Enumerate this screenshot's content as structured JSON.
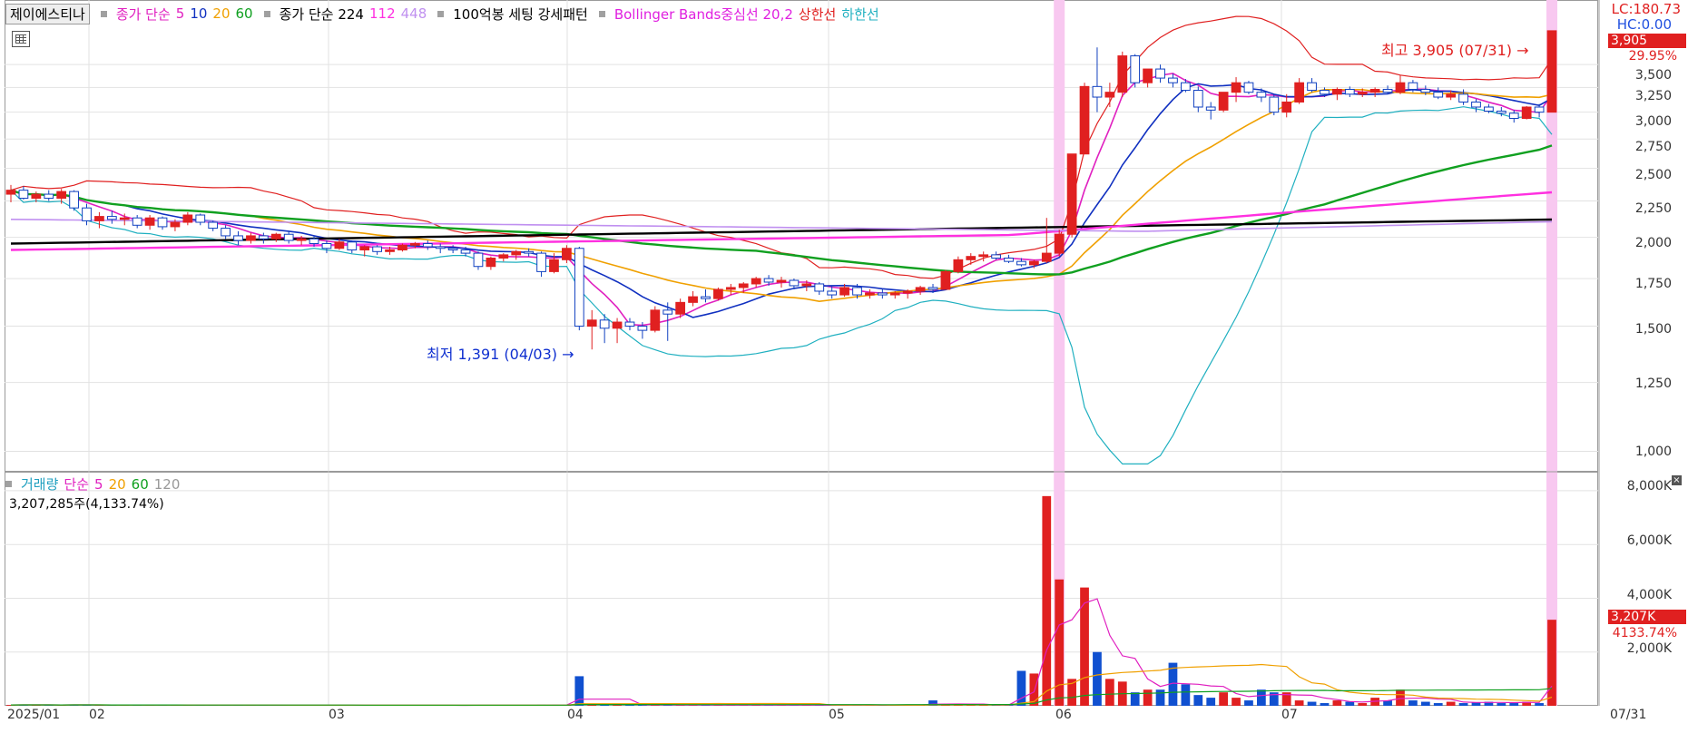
{
  "legend": {
    "name": "제이에스티나",
    "ma_label": "종가 단순",
    "ma_values": [
      "5",
      "10",
      "20",
      "60"
    ],
    "ma_colors": [
      "#e020c0",
      "#1030c0",
      "#f0a000",
      "#10a020"
    ],
    "long_label": "종가 단순 224",
    "long_values": [
      "112",
      "448"
    ],
    "pattern": "100억봉 세팅 강세패턴",
    "bb_label": "Bollinger Bands중심선 20,2",
    "bb_upper": "상한선",
    "bb_lower": "하한선"
  },
  "top_right": {
    "lc": "LC:180.73",
    "hc": "HC:0.00"
  },
  "price_axis": [
    "3,500",
    "3,250",
    "3,000",
    "2,750",
    "2,500",
    "2,250",
    "2,000",
    "1,750",
    "1,500",
    "1,250",
    "1,000"
  ],
  "price_tag": {
    "value": "3,905",
    "pct": "29.95%"
  },
  "high_note": "최고 3,905 (07/31)",
  "low_note": "최저 1,391 (04/03)",
  "volume": {
    "legend_label": "거래량",
    "ma_label": "단순",
    "ma_values": [
      "5",
      "20",
      "60",
      "120"
    ],
    "total": "3,207,285주(4,133.74%)",
    "axis": [
      "8,000K",
      "6,000K",
      "4,000K",
      "2,000K"
    ],
    "tag_value": "3,207K",
    "tag_pct": "4133.74%"
  },
  "months": [
    "2025/01",
    "02",
    "03",
    "04",
    "05",
    "06",
    "07",
    "07/31"
  ],
  "chart_data": {
    "type": "candlestick",
    "title": "제이에스티나",
    "y_scale": "log",
    "ylim": [
      950,
      3950
    ],
    "volume_ylim": [
      0,
      8200
    ],
    "volume_unit": "K",
    "high": 3905,
    "low": 1391,
    "candles": [
      {
        "o": 2300,
        "h": 2370,
        "l": 2240,
        "c": 2330
      },
      {
        "o": 2330,
        "h": 2360,
        "l": 2260,
        "c": 2270
      },
      {
        "o": 2270,
        "h": 2320,
        "l": 2240,
        "c": 2300
      },
      {
        "o": 2300,
        "h": 2330,
        "l": 2250,
        "c": 2270
      },
      {
        "o": 2270,
        "h": 2340,
        "l": 2230,
        "c": 2320
      },
      {
        "o": 2320,
        "h": 2330,
        "l": 2180,
        "c": 2200
      },
      {
        "o": 2200,
        "h": 2230,
        "l": 2080,
        "c": 2110
      },
      {
        "o": 2110,
        "h": 2170,
        "l": 2060,
        "c": 2140
      },
      {
        "o": 2140,
        "h": 2180,
        "l": 2090,
        "c": 2120
      },
      {
        "o": 2120,
        "h": 2160,
        "l": 2080,
        "c": 2130
      },
      {
        "o": 2130,
        "h": 2150,
        "l": 2060,
        "c": 2080
      },
      {
        "o": 2080,
        "h": 2150,
        "l": 2050,
        "c": 2130
      },
      {
        "o": 2130,
        "h": 2140,
        "l": 2050,
        "c": 2070
      },
      {
        "o": 2070,
        "h": 2120,
        "l": 2040,
        "c": 2100
      },
      {
        "o": 2100,
        "h": 2170,
        "l": 2080,
        "c": 2150
      },
      {
        "o": 2150,
        "h": 2160,
        "l": 2080,
        "c": 2100
      },
      {
        "o": 2100,
        "h": 2110,
        "l": 2040,
        "c": 2060
      },
      {
        "o": 2060,
        "h": 2080,
        "l": 1990,
        "c": 2010
      },
      {
        "o": 2010,
        "h": 2040,
        "l": 1950,
        "c": 1980
      },
      {
        "o": 1980,
        "h": 2030,
        "l": 1960,
        "c": 2010
      },
      {
        "o": 2010,
        "h": 2030,
        "l": 1960,
        "c": 1990
      },
      {
        "o": 1990,
        "h": 2030,
        "l": 1970,
        "c": 2020
      },
      {
        "o": 2020,
        "h": 2040,
        "l": 1960,
        "c": 1980
      },
      {
        "o": 1980,
        "h": 2010,
        "l": 1950,
        "c": 1990
      },
      {
        "o": 1990,
        "h": 2010,
        "l": 1940,
        "c": 1960
      },
      {
        "o": 1960,
        "h": 1980,
        "l": 1900,
        "c": 1930
      },
      {
        "o": 1930,
        "h": 1990,
        "l": 1920,
        "c": 1970
      },
      {
        "o": 1970,
        "h": 1980,
        "l": 1900,
        "c": 1920
      },
      {
        "o": 1920,
        "h": 1950,
        "l": 1880,
        "c": 1940
      },
      {
        "o": 1940,
        "h": 1950,
        "l": 1890,
        "c": 1910
      },
      {
        "o": 1910,
        "h": 1940,
        "l": 1890,
        "c": 1920
      },
      {
        "o": 1920,
        "h": 1960,
        "l": 1910,
        "c": 1950
      },
      {
        "o": 1950,
        "h": 1970,
        "l": 1930,
        "c": 1960
      },
      {
        "o": 1960,
        "h": 1980,
        "l": 1920,
        "c": 1940
      },
      {
        "o": 1940,
        "h": 1960,
        "l": 1900,
        "c": 1930
      },
      {
        "o": 1930,
        "h": 1950,
        "l": 1900,
        "c": 1920
      },
      {
        "o": 1920,
        "h": 1940,
        "l": 1880,
        "c": 1900
      },
      {
        "o": 1900,
        "h": 1910,
        "l": 1800,
        "c": 1820
      },
      {
        "o": 1820,
        "h": 1880,
        "l": 1800,
        "c": 1870
      },
      {
        "o": 1870,
        "h": 1900,
        "l": 1850,
        "c": 1890
      },
      {
        "o": 1890,
        "h": 1920,
        "l": 1860,
        "c": 1910
      },
      {
        "o": 1910,
        "h": 1930,
        "l": 1880,
        "c": 1900
      },
      {
        "o": 1900,
        "h": 1910,
        "l": 1760,
        "c": 1790
      },
      {
        "o": 1790,
        "h": 1900,
        "l": 1780,
        "c": 1860
      },
      {
        "o": 1860,
        "h": 1950,
        "l": 1840,
        "c": 1930
      },
      {
        "o": 1930,
        "h": 1940,
        "l": 1480,
        "c": 1500
      },
      {
        "o": 1500,
        "h": 1580,
        "l": 1391,
        "c": 1530
      },
      {
        "o": 1530,
        "h": 1560,
        "l": 1420,
        "c": 1490
      },
      {
        "o": 1490,
        "h": 1540,
        "l": 1420,
        "c": 1520
      },
      {
        "o": 1520,
        "h": 1540,
        "l": 1480,
        "c": 1500
      },
      {
        "o": 1500,
        "h": 1520,
        "l": 1440,
        "c": 1480
      },
      {
        "o": 1480,
        "h": 1600,
        "l": 1470,
        "c": 1580
      },
      {
        "o": 1580,
        "h": 1620,
        "l": 1430,
        "c": 1560
      },
      {
        "o": 1560,
        "h": 1640,
        "l": 1540,
        "c": 1620
      },
      {
        "o": 1620,
        "h": 1680,
        "l": 1600,
        "c": 1650
      },
      {
        "o": 1650,
        "h": 1690,
        "l": 1620,
        "c": 1640
      },
      {
        "o": 1640,
        "h": 1700,
        "l": 1630,
        "c": 1690
      },
      {
        "o": 1690,
        "h": 1720,
        "l": 1660,
        "c": 1700
      },
      {
        "o": 1700,
        "h": 1730,
        "l": 1670,
        "c": 1720
      },
      {
        "o": 1720,
        "h": 1760,
        "l": 1700,
        "c": 1750
      },
      {
        "o": 1750,
        "h": 1770,
        "l": 1710,
        "c": 1730
      },
      {
        "o": 1730,
        "h": 1760,
        "l": 1700,
        "c": 1740
      },
      {
        "o": 1740,
        "h": 1750,
        "l": 1690,
        "c": 1710
      },
      {
        "o": 1710,
        "h": 1740,
        "l": 1680,
        "c": 1720
      },
      {
        "o": 1720,
        "h": 1730,
        "l": 1660,
        "c": 1680
      },
      {
        "o": 1680,
        "h": 1710,
        "l": 1640,
        "c": 1660
      },
      {
        "o": 1660,
        "h": 1720,
        "l": 1650,
        "c": 1700
      },
      {
        "o": 1700,
        "h": 1720,
        "l": 1640,
        "c": 1660
      },
      {
        "o": 1660,
        "h": 1690,
        "l": 1640,
        "c": 1670
      },
      {
        "o": 1670,
        "h": 1690,
        "l": 1640,
        "c": 1660
      },
      {
        "o": 1660,
        "h": 1680,
        "l": 1640,
        "c": 1670
      },
      {
        "o": 1670,
        "h": 1690,
        "l": 1640,
        "c": 1680
      },
      {
        "o": 1680,
        "h": 1710,
        "l": 1660,
        "c": 1700
      },
      {
        "o": 1700,
        "h": 1720,
        "l": 1670,
        "c": 1690
      },
      {
        "o": 1690,
        "h": 1800,
        "l": 1690,
        "c": 1790
      },
      {
        "o": 1790,
        "h": 1880,
        "l": 1780,
        "c": 1860
      },
      {
        "o": 1860,
        "h": 1900,
        "l": 1830,
        "c": 1880
      },
      {
        "o": 1880,
        "h": 1910,
        "l": 1850,
        "c": 1890
      },
      {
        "o": 1890,
        "h": 1910,
        "l": 1860,
        "c": 1870
      },
      {
        "o": 1870,
        "h": 1890,
        "l": 1840,
        "c": 1850
      },
      {
        "o": 1850,
        "h": 1870,
        "l": 1820,
        "c": 1830
      },
      {
        "o": 1830,
        "h": 1860,
        "l": 1810,
        "c": 1850
      },
      {
        "o": 1850,
        "h": 2130,
        "l": 1840,
        "c": 1900
      },
      {
        "o": 1900,
        "h": 2050,
        "l": 1880,
        "c": 2020
      },
      {
        "o": 2020,
        "h": 2620,
        "l": 2000,
        "c": 2620
      },
      {
        "o": 2620,
        "h": 3300,
        "l": 2700,
        "c": 3260
      },
      {
        "o": 3260,
        "h": 3700,
        "l": 3000,
        "c": 3150
      },
      {
        "o": 3150,
        "h": 3300,
        "l": 3050,
        "c": 3200
      },
      {
        "o": 3200,
        "h": 3650,
        "l": 3150,
        "c": 3600
      },
      {
        "o": 3600,
        "h": 3620,
        "l": 3250,
        "c": 3300
      },
      {
        "o": 3300,
        "h": 3450,
        "l": 3250,
        "c": 3450
      },
      {
        "o": 3450,
        "h": 3500,
        "l": 3300,
        "c": 3350
      },
      {
        "o": 3350,
        "h": 3400,
        "l": 3250,
        "c": 3300
      },
      {
        "o": 3300,
        "h": 3340,
        "l": 3200,
        "c": 3220
      },
      {
        "o": 3220,
        "h": 3260,
        "l": 3000,
        "c": 3050
      },
      {
        "o": 3050,
        "h": 3100,
        "l": 2930,
        "c": 3020
      },
      {
        "o": 3020,
        "h": 3200,
        "l": 3000,
        "c": 3200
      },
      {
        "o": 3200,
        "h": 3360,
        "l": 3100,
        "c": 3300
      },
      {
        "o": 3300,
        "h": 3320,
        "l": 3180,
        "c": 3200
      },
      {
        "o": 3200,
        "h": 3240,
        "l": 3100,
        "c": 3150
      },
      {
        "o": 3150,
        "h": 3180,
        "l": 2970,
        "c": 3000
      },
      {
        "o": 3000,
        "h": 3180,
        "l": 2950,
        "c": 3100
      },
      {
        "o": 3100,
        "h": 3350,
        "l": 3080,
        "c": 3300
      },
      {
        "o": 3300,
        "h": 3350,
        "l": 3200,
        "c": 3220
      },
      {
        "o": 3220,
        "h": 3250,
        "l": 3150,
        "c": 3180
      },
      {
        "o": 3180,
        "h": 3250,
        "l": 3120,
        "c": 3230
      },
      {
        "o": 3230,
        "h": 3260,
        "l": 3150,
        "c": 3180
      },
      {
        "o": 3180,
        "h": 3240,
        "l": 3150,
        "c": 3200
      },
      {
        "o": 3200,
        "h": 3250,
        "l": 3150,
        "c": 3230
      },
      {
        "o": 3230,
        "h": 3270,
        "l": 3180,
        "c": 3200
      },
      {
        "o": 3200,
        "h": 3380,
        "l": 3180,
        "c": 3300
      },
      {
        "o": 3300,
        "h": 3330,
        "l": 3200,
        "c": 3230
      },
      {
        "o": 3230,
        "h": 3270,
        "l": 3170,
        "c": 3200
      },
      {
        "o": 3200,
        "h": 3250,
        "l": 3130,
        "c": 3150
      },
      {
        "o": 3150,
        "h": 3220,
        "l": 3120,
        "c": 3180
      },
      {
        "o": 3180,
        "h": 3230,
        "l": 3070,
        "c": 3100
      },
      {
        "o": 3100,
        "h": 3130,
        "l": 3000,
        "c": 3050
      },
      {
        "o": 3050,
        "h": 3080,
        "l": 2990,
        "c": 3010
      },
      {
        "o": 3010,
        "h": 3050,
        "l": 2960,
        "c": 2990
      },
      {
        "o": 2990,
        "h": 3020,
        "l": 2900,
        "c": 2940
      },
      {
        "o": 2940,
        "h": 3060,
        "l": 2930,
        "c": 3050
      },
      {
        "o": 3050,
        "h": 3080,
        "l": 2950,
        "c": 3000
      },
      {
        "o": 3000,
        "h": 3905,
        "l": 3000,
        "c": 3905
      }
    ],
    "volume": [
      30,
      40,
      35,
      25,
      30,
      45,
      30,
      25,
      20,
      30,
      25,
      20,
      25,
      30,
      20,
      20,
      25,
      30,
      20,
      20,
      15,
      20,
      25,
      20,
      15,
      20,
      30,
      20,
      15,
      20,
      20,
      25,
      20,
      15,
      20,
      15,
      20,
      30,
      20,
      20,
      25,
      20,
      40,
      30,
      25,
      1100,
      35,
      40,
      30,
      30,
      40,
      30,
      35,
      25,
      25,
      30,
      25,
      20,
      25,
      30,
      25,
      20,
      25,
      20,
      20,
      25,
      30,
      20,
      20,
      25,
      20,
      30,
      25,
      200,
      40,
      35,
      25,
      20,
      30,
      25,
      1300,
      1200,
      7800,
      4700,
      1000,
      4400,
      2000,
      1000,
      900,
      500,
      600,
      600,
      1600,
      800,
      400,
      300,
      500,
      300,
      200,
      600,
      500,
      500,
      200,
      150,
      100,
      200,
      150,
      100,
      300,
      200,
      600,
      200,
      150,
      100,
      150,
      100,
      120,
      150,
      100,
      120,
      150,
      100,
      3200
    ],
    "ma_lines": [
      {
        "name": "5",
        "color": "#e020c0"
      },
      {
        "name": "10",
        "color": "#1030c0"
      },
      {
        "name": "20",
        "color": "#f0a000"
      },
      {
        "name": "60",
        "color": "#10a020"
      },
      {
        "name": "224",
        "color": "#000000"
      },
      {
        "name": "112",
        "color": "#ff30e0"
      },
      {
        "name": "448",
        "color": "#c090f0"
      }
    ],
    "bollinger": {
      "upper_color": "#e02020",
      "lower_color": "#20b0c0"
    },
    "x_labels": [
      "2025/01",
      "02",
      "03",
      "04",
      "05",
      "06",
      "07",
      "07/31"
    ]
  }
}
